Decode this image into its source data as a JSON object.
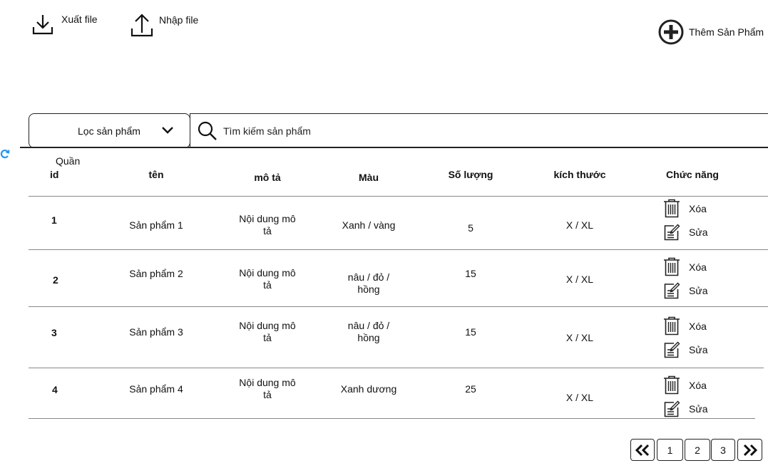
{
  "toolbar": {
    "export_label": "Xuất file",
    "import_label": "Nhập file",
    "add_label": "Thêm Sản Phẩm"
  },
  "filter": {
    "label": "Lọc sản phẩm"
  },
  "search": {
    "placeholder": "Tìm kiếm sản phẩm"
  },
  "table": {
    "extra_header": "Quần",
    "headers": {
      "id": "id",
      "name": "tên",
      "description": "mô tả",
      "color": "Màu",
      "quantity": "Số lượng",
      "size": "kích thước",
      "actions": "Chức năng"
    },
    "rows": [
      {
        "id": "1",
        "name": "Sản phẩm 1",
        "desc_l1": "Nội dung mô",
        "desc_l2": "tả",
        "color_l1": "Xanh / vàng",
        "color_l2": "",
        "quantity": "5",
        "size": "X / XL"
      },
      {
        "id": "2",
        "name": "Sản phẩm 2",
        "desc_l1": "Nội dung mô",
        "desc_l2": "tả",
        "color_l1": "nâu / đỏ /",
        "color_l2": "hồng",
        "quantity": "15",
        "size": "X / XL"
      },
      {
        "id": "3",
        "name": "Sản phẩm 3",
        "desc_l1": "Nội dung mô",
        "desc_l2": "tả",
        "color_l1": "nâu / đỏ /",
        "color_l2": "hồng",
        "quantity": "15",
        "size": "X / XL"
      },
      {
        "id": "4",
        "name": "Sản phẩm 4",
        "desc_l1": "Nội dung mô",
        "desc_l2": "tả",
        "color_l1": "Xanh dương",
        "color_l2": "",
        "quantity": "25",
        "size": "X / XL"
      }
    ],
    "delete_label": "Xóa",
    "edit_label": "Sửa"
  },
  "pagination": {
    "first_icon": "double-chevron-left-icon",
    "last_icon": "double-chevron-right-icon",
    "pages": [
      "1",
      "2",
      "3"
    ]
  },
  "icons": {
    "export": "download-icon",
    "import": "upload-icon",
    "add": "plus-circle-icon",
    "filter": "chevron-down-icon",
    "search": "search-icon",
    "refresh": "refresh-icon",
    "delete": "trash-icon",
    "edit": "edit-note-icon"
  },
  "colors": {
    "refresh": "#2196f3",
    "text": "#111111",
    "divider": "#888888"
  }
}
